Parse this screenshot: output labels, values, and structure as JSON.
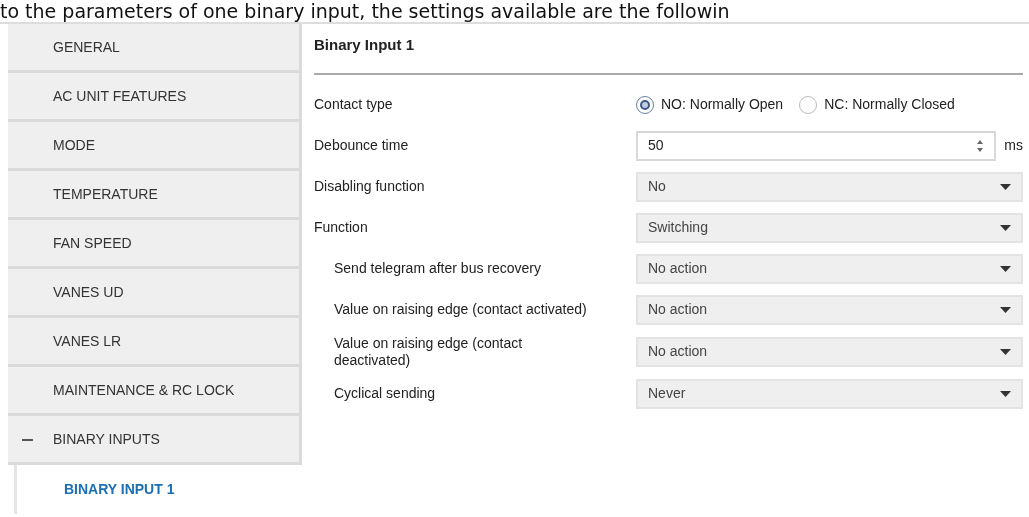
{
  "caption": "to the parameters of one binary input, the settings available are the followin",
  "sidebar": {
    "items": [
      {
        "label": "GENERAL",
        "selected": false
      },
      {
        "label": "AC UNIT FEATURES",
        "selected": false
      },
      {
        "label": "MODE",
        "selected": false
      },
      {
        "label": "TEMPERATURE",
        "selected": false
      },
      {
        "label": "FAN SPEED",
        "selected": false
      },
      {
        "label": "VANES UD",
        "selected": false
      },
      {
        "label": "VANES LR",
        "selected": false
      },
      {
        "label": "MAINTENANCE & RC LOCK",
        "selected": false
      },
      {
        "label": "BINARY INPUTS",
        "selected": false,
        "expanded": true,
        "children": [
          {
            "label": "BINARY INPUT 1",
            "selected": true
          }
        ]
      }
    ]
  },
  "panel": {
    "title": "Binary Input 1",
    "params": [
      {
        "kind": "radio",
        "label": "Contact type",
        "indented": false,
        "options": [
          {
            "label": "NO: Normally Open",
            "selected": true
          },
          {
            "label": "NC: Normally Closed",
            "selected": false
          }
        ]
      },
      {
        "kind": "number",
        "label": "Debounce time",
        "indented": false,
        "value": "50",
        "unit": "ms"
      },
      {
        "kind": "select",
        "label": "Disabling function",
        "indented": false,
        "value": "No"
      },
      {
        "kind": "select",
        "label": "Function",
        "indented": false,
        "value": "Switching"
      },
      {
        "kind": "select",
        "label": "Send telegram after bus recovery",
        "indented": true,
        "value": "No action"
      },
      {
        "kind": "select",
        "label": "Value on raising edge (contact activated)",
        "indented": true,
        "value": "No action"
      },
      {
        "kind": "select",
        "label": "Value on raising edge (contact deactivated)",
        "indented": true,
        "value": "No action"
      },
      {
        "kind": "select",
        "label": "Cyclical sending",
        "indented": true,
        "value": "Never"
      }
    ]
  }
}
